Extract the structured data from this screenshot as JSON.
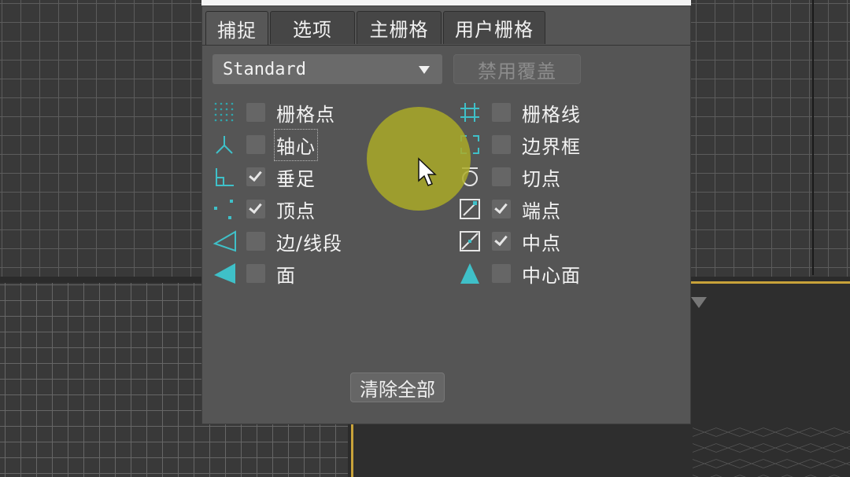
{
  "tabs": [
    {
      "label": "捕捉",
      "active": true
    },
    {
      "label": "选项",
      "active": false
    },
    {
      "label": "主栅格",
      "active": false
    },
    {
      "label": "用户栅格",
      "active": false
    }
  ],
  "snap_preset": {
    "selected": "Standard"
  },
  "override_button": {
    "label": "禁用覆盖",
    "enabled": false
  },
  "snaps_left": [
    {
      "icon": "grid-points-icon",
      "label": "栅格点",
      "checked": false
    },
    {
      "icon": "pivot-icon",
      "label": "轴心",
      "checked": false
    },
    {
      "icon": "perpendicular-icon",
      "label": "垂足",
      "checked": true
    },
    {
      "icon": "vertex-icon",
      "label": "顶点",
      "checked": true
    },
    {
      "icon": "edge-segment-icon",
      "label": "边/线段",
      "checked": false
    },
    {
      "icon": "face-icon",
      "label": "面",
      "checked": false
    }
  ],
  "snaps_right": [
    {
      "icon": "grid-lines-icon",
      "label": "栅格线",
      "checked": false
    },
    {
      "icon": "bounding-box-icon",
      "label": "边界框",
      "checked": false
    },
    {
      "icon": "tangent-icon",
      "label": "切点",
      "checked": false
    },
    {
      "icon": "endpoint-icon",
      "label": "端点",
      "checked": true
    },
    {
      "icon": "midpoint-icon",
      "label": "中点",
      "checked": true
    },
    {
      "icon": "center-face-icon",
      "label": "中心面",
      "checked": false
    }
  ],
  "clear_button": {
    "label": "清除全部"
  },
  "colors": {
    "accent": "#3fc0c8",
    "highlight": "#aaaa28",
    "panel": "#555555",
    "viewport_border": "#c8a23a"
  }
}
